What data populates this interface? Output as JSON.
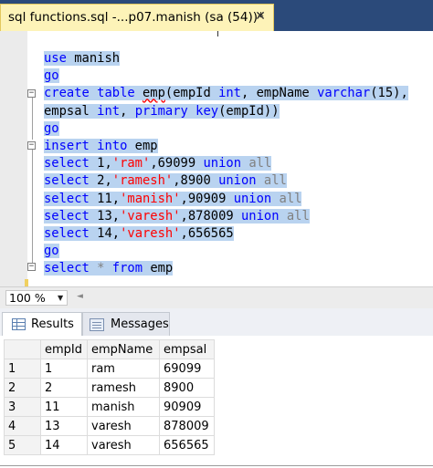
{
  "tab": {
    "title": "sql functions.sql -...p07.manish (sa (54))*",
    "close_glyph": "✕"
  },
  "editor": {
    "lines": [
      {
        "tokens": [
          {
            "t": "use",
            "c": "kw"
          },
          {
            "t": " manish",
            "c": "plain"
          }
        ]
      },
      {
        "tokens": [
          {
            "t": "go",
            "c": "kw"
          }
        ]
      },
      {
        "tokens": [
          {
            "t": "create table ",
            "c": "kw"
          },
          {
            "t": "emp",
            "c": "squig"
          },
          {
            "t": "(empId ",
            "c": "plain"
          },
          {
            "t": "int",
            "c": "kw"
          },
          {
            "t": ", empName ",
            "c": "plain"
          },
          {
            "t": "varchar",
            "c": "kw"
          },
          {
            "t": "(15),",
            "c": "plain"
          }
        ]
      },
      {
        "tokens": [
          {
            "t": "empsal ",
            "c": "plain"
          },
          {
            "t": "int",
            "c": "kw"
          },
          {
            "t": ", ",
            "c": "plain"
          },
          {
            "t": "primary key",
            "c": "kw"
          },
          {
            "t": "(empId))",
            "c": "plain"
          }
        ]
      },
      {
        "tokens": [
          {
            "t": "go",
            "c": "kw"
          }
        ]
      },
      {
        "tokens": [
          {
            "t": "insert into",
            "c": "kw"
          },
          {
            "t": " emp",
            "c": "plain"
          }
        ]
      },
      {
        "tokens": [
          {
            "t": "select",
            "c": "kw"
          },
          {
            "t": " 1,",
            "c": "plain"
          },
          {
            "t": "'ram'",
            "c": "str"
          },
          {
            "t": ",69099 ",
            "c": "plain"
          },
          {
            "t": "union",
            "c": "kw"
          },
          {
            "t": " ",
            "c": "plain"
          },
          {
            "t": "all",
            "c": "op"
          }
        ]
      },
      {
        "tokens": [
          {
            "t": "select",
            "c": "kw"
          },
          {
            "t": " 2,",
            "c": "plain"
          },
          {
            "t": "'ramesh'",
            "c": "str"
          },
          {
            "t": ",8900 ",
            "c": "plain"
          },
          {
            "t": "union",
            "c": "kw"
          },
          {
            "t": " ",
            "c": "plain"
          },
          {
            "t": "all",
            "c": "op"
          }
        ]
      },
      {
        "tokens": [
          {
            "t": "select",
            "c": "kw"
          },
          {
            "t": " 11,",
            "c": "plain"
          },
          {
            "t": "'manish'",
            "c": "str"
          },
          {
            "t": ",90909 ",
            "c": "plain"
          },
          {
            "t": "union",
            "c": "kw"
          },
          {
            "t": " ",
            "c": "plain"
          },
          {
            "t": "all",
            "c": "op"
          }
        ]
      },
      {
        "tokens": [
          {
            "t": "select",
            "c": "kw"
          },
          {
            "t": " 13,",
            "c": "plain"
          },
          {
            "t": "'varesh'",
            "c": "str"
          },
          {
            "t": ",878009 ",
            "c": "plain"
          },
          {
            "t": "union",
            "c": "kw"
          },
          {
            "t": " ",
            "c": "plain"
          },
          {
            "t": "all",
            "c": "op"
          }
        ]
      },
      {
        "tokens": [
          {
            "t": "select",
            "c": "kw"
          },
          {
            "t": " 14,",
            "c": "plain"
          },
          {
            "t": "'varesh'",
            "c": "str"
          },
          {
            "t": ",656565",
            "c": "plain"
          }
        ]
      },
      {
        "tokens": [
          {
            "t": "go",
            "c": "kw"
          }
        ]
      },
      {
        "tokens": [
          {
            "t": "select",
            "c": "kw"
          },
          {
            "t": " ",
            "c": "plain"
          },
          {
            "t": "*",
            "c": "op"
          },
          {
            "t": " ",
            "c": "plain"
          },
          {
            "t": "from",
            "c": "kw"
          },
          {
            "t": " emp",
            "c": "plain"
          }
        ]
      }
    ],
    "colors": {
      "keyword": "#0000ff",
      "string": "#ff0000",
      "operator": "#808080",
      "selection": "#b9d3f0"
    }
  },
  "zoom": {
    "value": "100 %"
  },
  "results": {
    "tabs": [
      {
        "label": "Results",
        "icon": "results-grid-icon",
        "active": true
      },
      {
        "label": "Messages",
        "icon": "messages-icon",
        "active": false
      }
    ],
    "columns": [
      "empId",
      "empName",
      "empsal"
    ],
    "rows": [
      {
        "num": "1",
        "empId": "1",
        "empName": "ram",
        "empsal": "69099"
      },
      {
        "num": "2",
        "empId": "2",
        "empName": "ramesh",
        "empsal": "8900"
      },
      {
        "num": "3",
        "empId": "11",
        "empName": "manish",
        "empsal": "90909"
      },
      {
        "num": "4",
        "empId": "13",
        "empName": "varesh",
        "empsal": "878009"
      },
      {
        "num": "5",
        "empId": "14",
        "empName": "varesh",
        "empsal": "656565"
      }
    ]
  }
}
